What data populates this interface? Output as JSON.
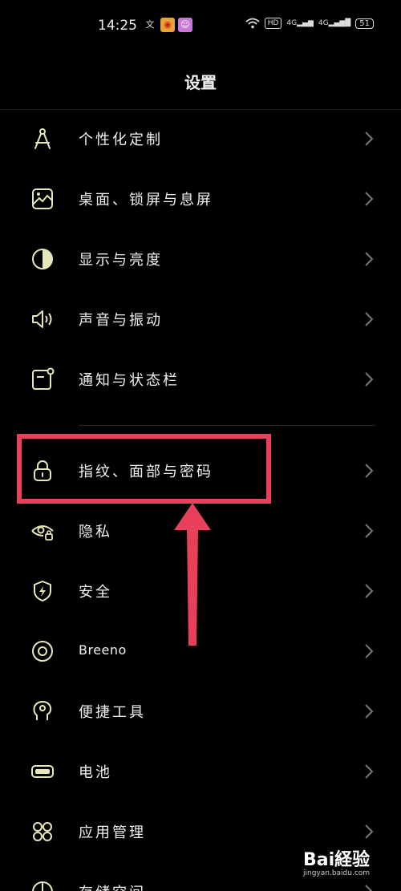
{
  "status_bar": {
    "time": "14:25",
    "left_icons": [
      "text-icon",
      "weibo-icon",
      "app-icon"
    ],
    "hd_label": "HD",
    "signal1": "4G",
    "signal2": "4G",
    "battery": "51"
  },
  "header": {
    "title": "设置"
  },
  "menu": {
    "items": [
      {
        "label": "个性化定制",
        "icon": "compass-icon"
      },
      {
        "label": "桌面、锁屏与息屏",
        "icon": "wallpaper-icon"
      },
      {
        "label": "显示与亮度",
        "icon": "brightness-icon"
      },
      {
        "label": "声音与振动",
        "icon": "speaker-icon"
      },
      {
        "label": "通知与状态栏",
        "icon": "notification-icon"
      },
      {
        "label": "指纹、面部与密码",
        "icon": "lock-icon"
      },
      {
        "label": "隐私",
        "icon": "privacy-eye-icon"
      },
      {
        "label": "安全",
        "icon": "shield-icon"
      },
      {
        "label": "Breeno",
        "icon": "breeno-icon"
      },
      {
        "label": "便捷工具",
        "icon": "tools-icon"
      },
      {
        "label": "电池",
        "icon": "battery-icon"
      },
      {
        "label": "应用管理",
        "icon": "apps-icon"
      },
      {
        "label": "存储空间",
        "icon": "storage-icon"
      }
    ]
  },
  "colors": {
    "accent_icon": "#e6e6b8",
    "highlight": "#e8405a",
    "chevron": "#777777"
  },
  "watermark": {
    "logo": "Bai経验",
    "url": "jingyan.baidu.com"
  }
}
